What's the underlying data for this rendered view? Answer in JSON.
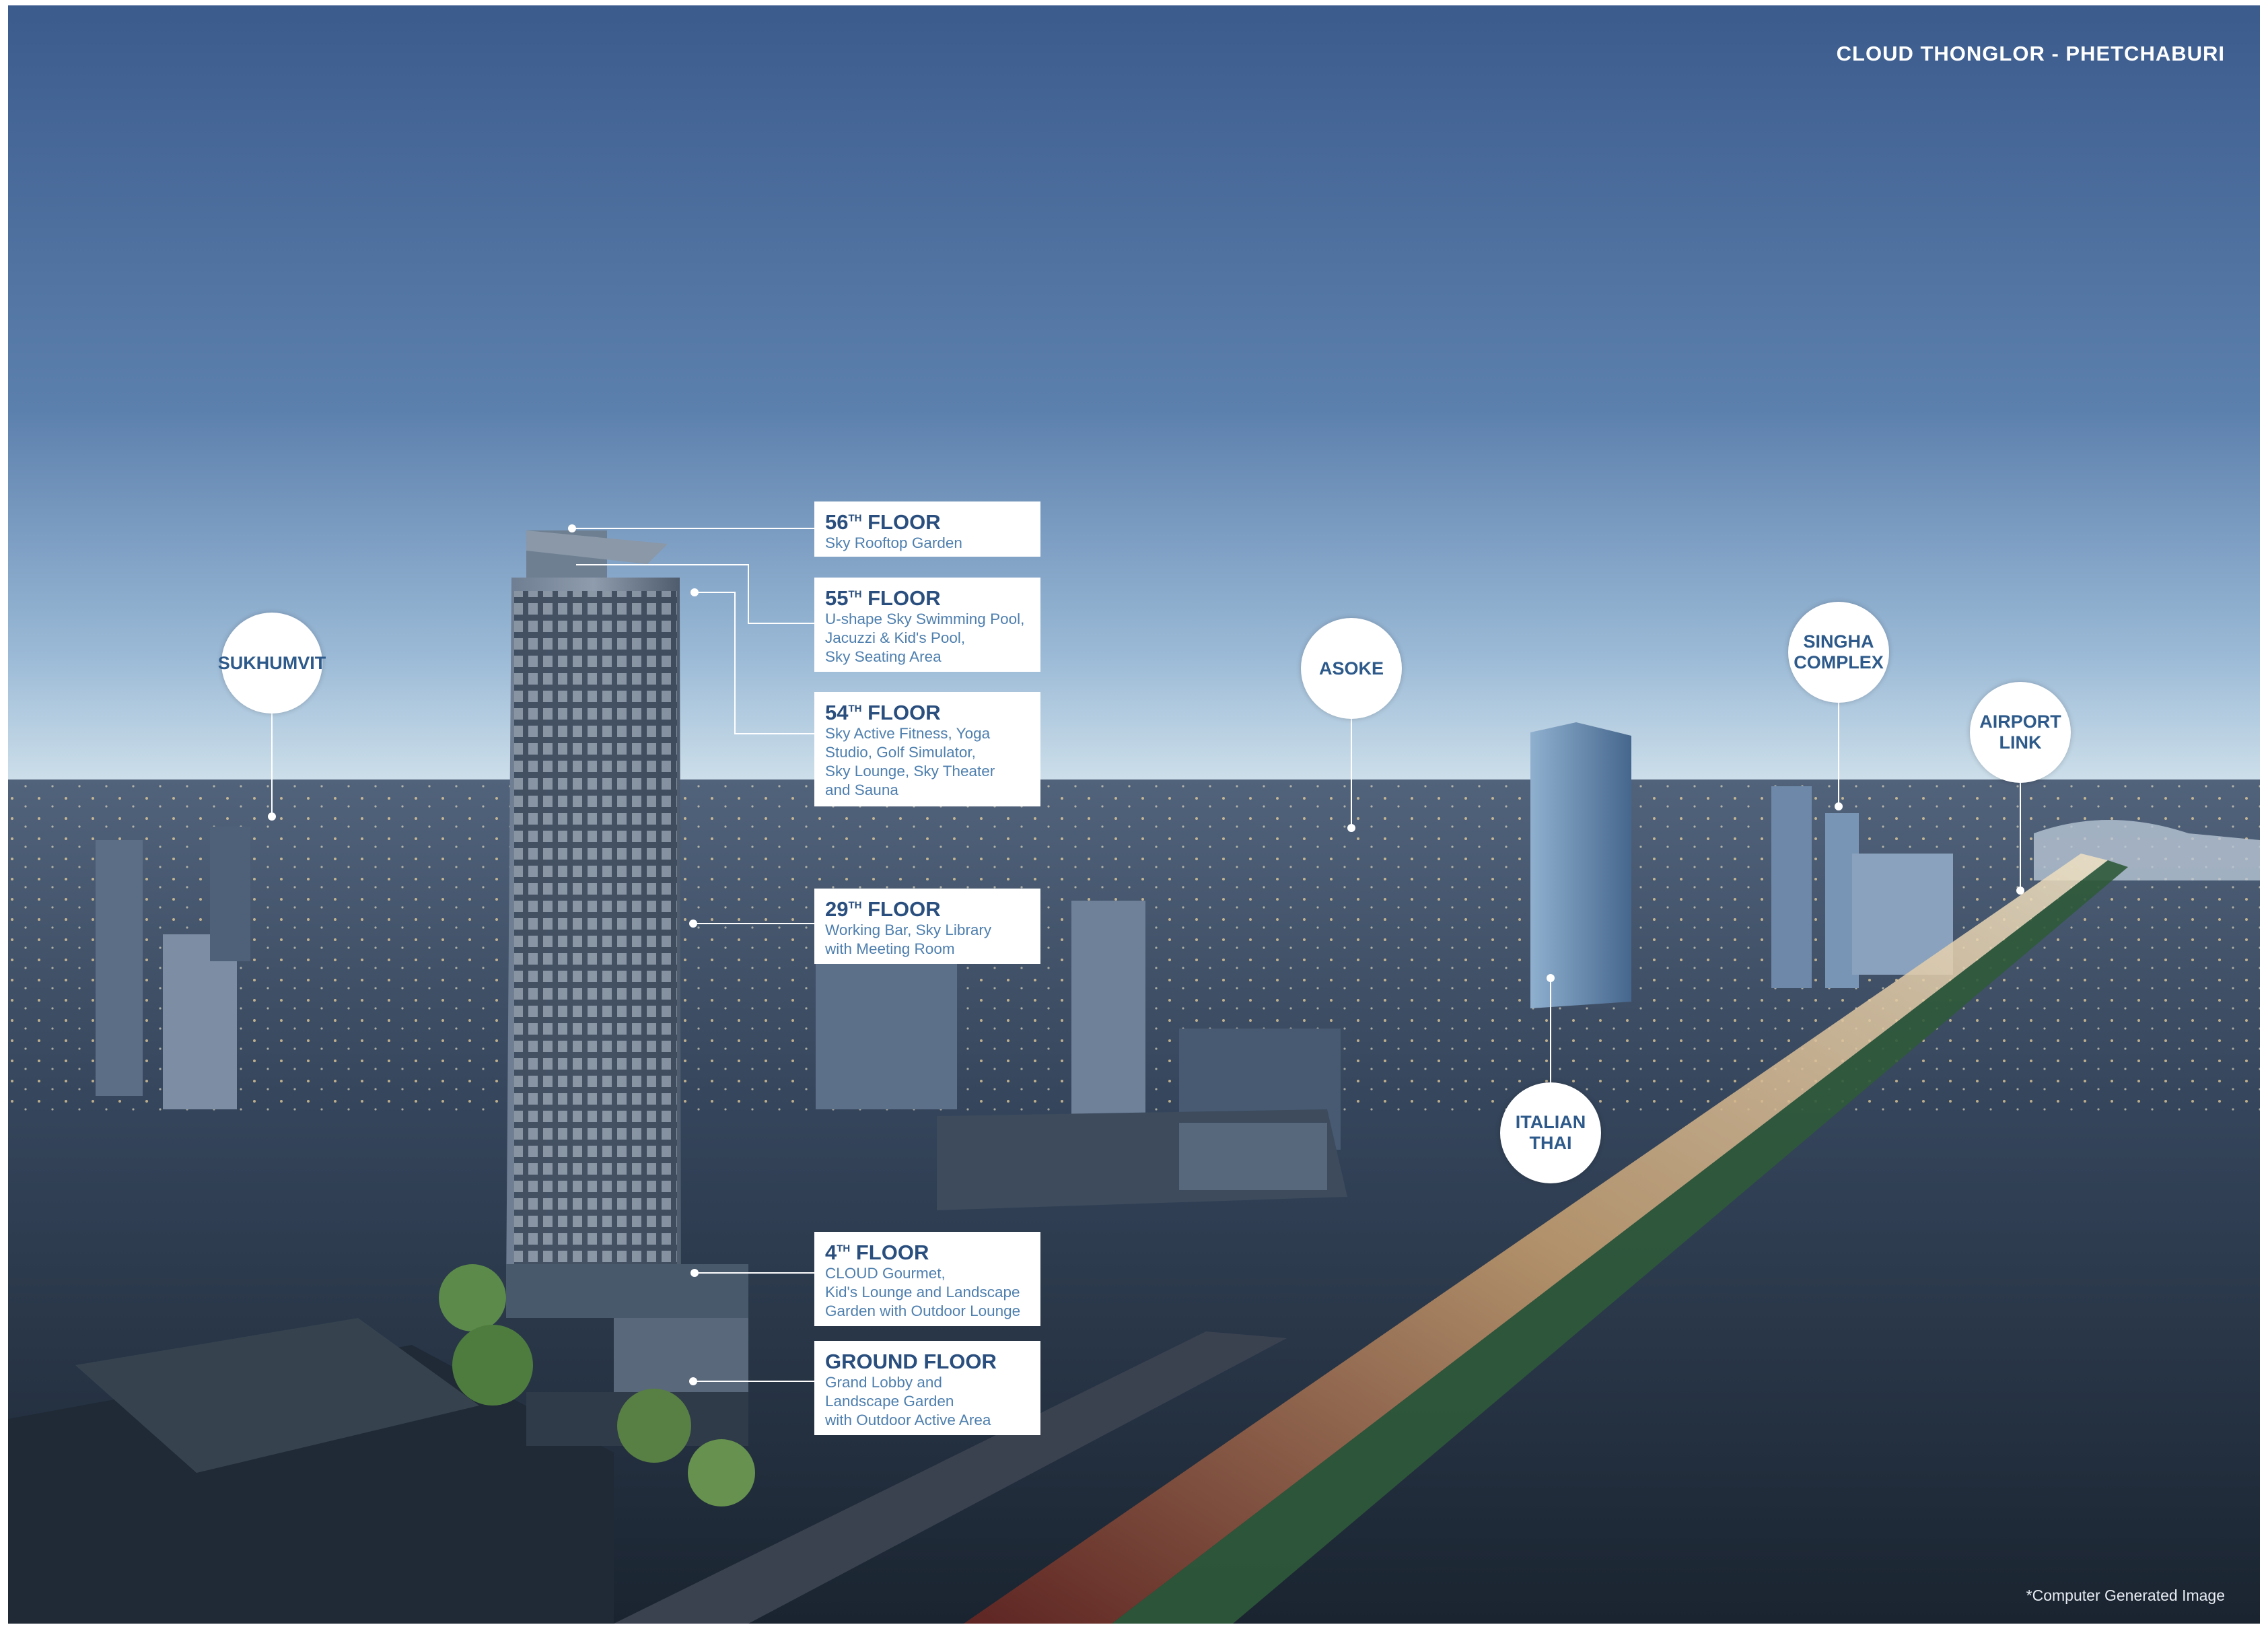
{
  "brand": "CLOUD THONGLOR - PHETCHABURI",
  "footnote": "*Computer Generated Image",
  "floors": [
    {
      "number": "56",
      "suffix": "TH",
      "word": "FLOOR",
      "desc": [
        "Sky Rooftop Garden"
      ]
    },
    {
      "number": "55",
      "suffix": "TH",
      "word": "FLOOR",
      "desc": [
        "U-shape Sky Swimming Pool,",
        "Jacuzzi & Kid's Pool,",
        "Sky Seating Area"
      ]
    },
    {
      "number": "54",
      "suffix": "TH",
      "word": "FLOOR",
      "desc": [
        "Sky Active Fitness, Yoga",
        "Studio, Golf Simulator,",
        "Sky Lounge, Sky Theater",
        "and Sauna"
      ]
    },
    {
      "number": "29",
      "suffix": "TH",
      "word": "FLOOR",
      "desc": [
        "Working Bar, Sky Library",
        "with Meeting Room"
      ]
    },
    {
      "number": "4",
      "suffix": "TH",
      "word": "FLOOR",
      "desc": [
        "CLOUD Gourmet,",
        "Kid's Lounge and Landscape",
        "Garden with Outdoor Lounge"
      ]
    },
    {
      "number": "GROUND",
      "suffix": "",
      "word": "FLOOR",
      "desc": [
        "Grand Lobby and",
        "Landscape Garden",
        "with Outdoor Active Area"
      ]
    }
  ],
  "landmarks": [
    {
      "lines": [
        "SUKHUMVIT"
      ]
    },
    {
      "lines": [
        "ASOKE"
      ]
    },
    {
      "lines": [
        "SINGHA",
        "COMPLEX"
      ]
    },
    {
      "lines": [
        "AIRPORT",
        "LINK"
      ]
    },
    {
      "lines": [
        "ITALIAN",
        "THAI"
      ]
    }
  ],
  "colors": {
    "label_text": "#2a4f7e",
    "sky_top": "#3d5f90",
    "sky_horizon": "#c9dbe8",
    "city": "#2b3a4c"
  }
}
